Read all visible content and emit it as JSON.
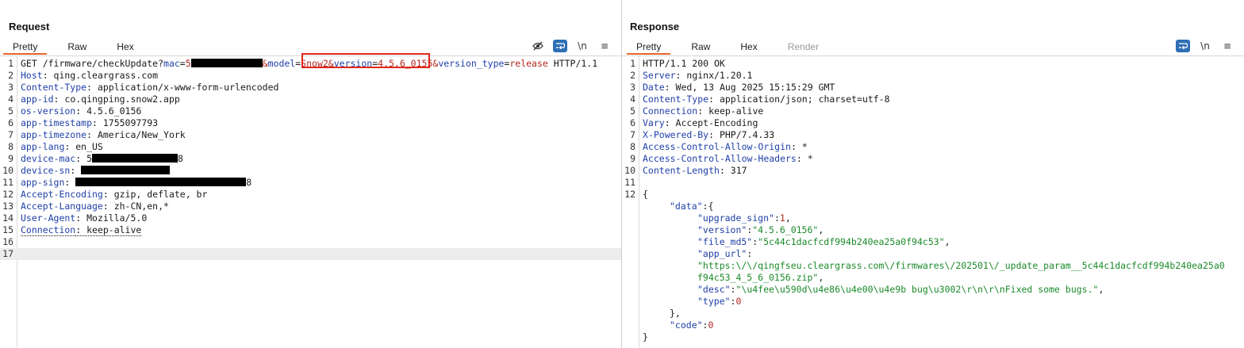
{
  "request": {
    "title": "Request",
    "tabs": [
      {
        "label": "Pretty",
        "active": true
      },
      {
        "label": "Raw"
      },
      {
        "label": "Hex"
      }
    ],
    "tools": [
      "eye-off-icon",
      "wrap-icon",
      "\\n",
      "≡"
    ],
    "lines": [
      {
        "n": "1",
        "parts": [
          {
            "t": "GET /firmware/checkUpdate?"
          },
          {
            "t": "mac",
            "c": "k-blue"
          },
          {
            "t": "=",
            "c": "k-dark"
          },
          {
            "t": "5",
            "c": "k-red"
          },
          {
            "redact": 90
          },
          {
            "t": "&",
            "c": "k-red"
          },
          {
            "t": "model",
            "c": "k-blue"
          },
          {
            "t": "=",
            "c": "k-dark"
          },
          {
            "t": "Snow2",
            "c": "k-red"
          },
          {
            "t": "&",
            "c": "k-red"
          },
          {
            "t": "version",
            "c": "k-blue"
          },
          {
            "t": "=",
            "c": "k-dark"
          },
          {
            "t": "4.5.6_0155",
            "c": "k-red"
          },
          {
            "t": "&",
            "c": "k-red"
          },
          {
            "t": "version_type",
            "c": "k-blue"
          },
          {
            "t": "=",
            "c": "k-dark"
          },
          {
            "t": "release",
            "c": "k-red"
          },
          {
            "t": " HTTP/1.1"
          }
        ]
      },
      {
        "n": "2",
        "parts": [
          {
            "t": "Host",
            "c": "k-blue"
          },
          {
            "t": ": qing.cleargrass.com"
          }
        ]
      },
      {
        "n": "3",
        "parts": [
          {
            "t": "Content-Type",
            "c": "k-blue"
          },
          {
            "t": ": application/x-www-form-urlencoded"
          }
        ]
      },
      {
        "n": "4",
        "parts": [
          {
            "t": "app-id",
            "c": "k-blue"
          },
          {
            "t": ": co.qingping.snow2.app"
          }
        ]
      },
      {
        "n": "5",
        "parts": [
          {
            "t": "os-version",
            "c": "k-blue"
          },
          {
            "t": ": 4.5.6_0156"
          }
        ]
      },
      {
        "n": "6",
        "parts": [
          {
            "t": "app-timestamp",
            "c": "k-blue"
          },
          {
            "t": ": 1755097793"
          }
        ]
      },
      {
        "n": "7",
        "parts": [
          {
            "t": "app-timezone",
            "c": "k-blue"
          },
          {
            "t": ": America/New_York"
          }
        ]
      },
      {
        "n": "8",
        "parts": [
          {
            "t": "app-lang",
            "c": "k-blue"
          },
          {
            "t": ": en_US"
          }
        ]
      },
      {
        "n": "9",
        "parts": [
          {
            "t": "device-mac",
            "c": "k-blue"
          },
          {
            "t": ": 5"
          },
          {
            "redact": 108
          },
          {
            "t": "8"
          }
        ]
      },
      {
        "n": "10",
        "parts": [
          {
            "t": "device-sn",
            "c": "k-blue"
          },
          {
            "t": ": "
          },
          {
            "redact": 112
          }
        ]
      },
      {
        "n": "11",
        "parts": [
          {
            "t": "app-sign",
            "c": "k-blue"
          },
          {
            "t": ": "
          },
          {
            "redact": 215
          },
          {
            "t": "8"
          }
        ]
      },
      {
        "n": "12",
        "parts": [
          {
            "t": "Accept-Encoding",
            "c": "k-blue"
          },
          {
            "t": ": gzip, deflate, br"
          }
        ]
      },
      {
        "n": "13",
        "parts": [
          {
            "t": "Accept-Language",
            "c": "k-blue"
          },
          {
            "t": ": zh-CN,en,*"
          }
        ]
      },
      {
        "n": "14",
        "parts": [
          {
            "t": "User-Agent",
            "c": "k-blue"
          },
          {
            "t": ": Mozilla/5.0"
          }
        ]
      },
      {
        "n": "15",
        "parts": [
          {
            "t": "Connection",
            "c": "k-blue",
            "dotted": true
          },
          {
            "t": ": keep-alive",
            "dotted": true
          }
        ]
      },
      {
        "n": "16",
        "parts": []
      },
      {
        "n": "17",
        "parts": [],
        "current": true
      }
    ]
  },
  "response": {
    "title": "Response",
    "tabs": [
      {
        "label": "Pretty",
        "active": true
      },
      {
        "label": "Raw"
      },
      {
        "label": "Hex"
      },
      {
        "label": "Render",
        "disabled": true
      }
    ],
    "tools": [
      "wrap-icon",
      "\\n",
      "≡"
    ],
    "lines": [
      {
        "n": "1",
        "parts": [
          {
            "t": "HTTP/1.1 200 OK"
          }
        ]
      },
      {
        "n": "2",
        "parts": [
          {
            "t": "Server",
            "c": "k-blue"
          },
          {
            "t": ": nginx/1.20.1"
          }
        ]
      },
      {
        "n": "3",
        "parts": [
          {
            "t": "Date",
            "c": "k-blue"
          },
          {
            "t": ": Wed, 13 Aug 2025 15:15:29 GMT"
          }
        ]
      },
      {
        "n": "4",
        "parts": [
          {
            "t": "Content-Type",
            "c": "k-blue"
          },
          {
            "t": ": application/json; charset=utf-8"
          }
        ]
      },
      {
        "n": "5",
        "parts": [
          {
            "t": "Connection",
            "c": "k-blue"
          },
          {
            "t": ": keep-alive"
          }
        ]
      },
      {
        "n": "6",
        "parts": [
          {
            "t": "Vary",
            "c": "k-blue"
          },
          {
            "t": ": Accept-Encoding"
          }
        ]
      },
      {
        "n": "7",
        "parts": [
          {
            "t": "X-Powered-By",
            "c": "k-blue"
          },
          {
            "t": ": PHP/7.4.33"
          }
        ]
      },
      {
        "n": "8",
        "parts": [
          {
            "t": "Access-Control-Allow-Origin",
            "c": "k-blue"
          },
          {
            "t": ": *"
          }
        ]
      },
      {
        "n": "9",
        "parts": [
          {
            "t": "Access-Control-Allow-Headers",
            "c": "k-blue"
          },
          {
            "t": ": *"
          }
        ]
      },
      {
        "n": "10",
        "parts": [
          {
            "t": "Content-Length",
            "c": "k-blue"
          },
          {
            "t": ": 317"
          }
        ]
      },
      {
        "n": "11",
        "parts": []
      },
      {
        "n": "12",
        "parts": [
          {
            "t": "{"
          }
        ]
      },
      {
        "n": "",
        "indent": 1,
        "parts": [
          {
            "t": "\"data\"",
            "c": "k-blue"
          },
          {
            "t": ":{"
          }
        ]
      },
      {
        "n": "",
        "indent": 2,
        "parts": [
          {
            "t": "\"upgrade_sign\"",
            "c": "k-blue"
          },
          {
            "t": ":"
          },
          {
            "t": "1",
            "c": "k-red"
          },
          {
            "t": ","
          }
        ]
      },
      {
        "n": "",
        "indent": 2,
        "parts": [
          {
            "t": "\"version\"",
            "c": "k-blue"
          },
          {
            "t": ":"
          },
          {
            "t": "\"4.5.6_0156\"",
            "c": "k-green"
          },
          {
            "t": ","
          }
        ]
      },
      {
        "n": "",
        "indent": 2,
        "parts": [
          {
            "t": "\"file_md5\"",
            "c": "k-blue"
          },
          {
            "t": ":"
          },
          {
            "t": "\"5c44c1dacfcdf994b240ea25a0f94c53\"",
            "c": "k-green"
          },
          {
            "t": ","
          }
        ]
      },
      {
        "n": "",
        "indent": 2,
        "parts": [
          {
            "t": "\"app_url\"",
            "c": "k-blue"
          },
          {
            "t": ":"
          }
        ]
      },
      {
        "n": "",
        "indent": 2,
        "parts": [
          {
            "t": "\"https:\\/\\/qingfseu.cleargrass.com\\/firmwares\\/202501\\/_update_param__5c44c1dacfcdf994b240ea25a0",
            "c": "k-green"
          }
        ]
      },
      {
        "n": "",
        "indent": 2,
        "parts": [
          {
            "t": "f94c53_4_5_6_0156.zip\"",
            "c": "k-green"
          },
          {
            "t": ","
          }
        ]
      },
      {
        "n": "",
        "indent": 2,
        "parts": [
          {
            "t": "\"desc\"",
            "c": "k-blue"
          },
          {
            "t": ":"
          },
          {
            "t": "\"\\u4fee\\u590d\\u4e86\\u4e00\\u4e9b bug\\u3002\\r\\n\\r\\nFixed some bugs.\"",
            "c": "k-green"
          },
          {
            "t": ","
          }
        ]
      },
      {
        "n": "",
        "indent": 2,
        "parts": [
          {
            "t": "\"type\"",
            "c": "k-blue"
          },
          {
            "t": ":"
          },
          {
            "t": "0",
            "c": "k-red"
          }
        ]
      },
      {
        "n": "",
        "indent": 1,
        "parts": [
          {
            "t": "},"
          }
        ]
      },
      {
        "n": "",
        "indent": 1,
        "parts": [
          {
            "t": "\"code\"",
            "c": "k-blue"
          },
          {
            "t": ":"
          },
          {
            "t": "0",
            "c": "k-red"
          }
        ]
      },
      {
        "n": "",
        "parts": [
          {
            "t": "}"
          }
        ]
      }
    ]
  },
  "layout_buttons": [
    "side-by-side",
    "stacked",
    "single"
  ]
}
